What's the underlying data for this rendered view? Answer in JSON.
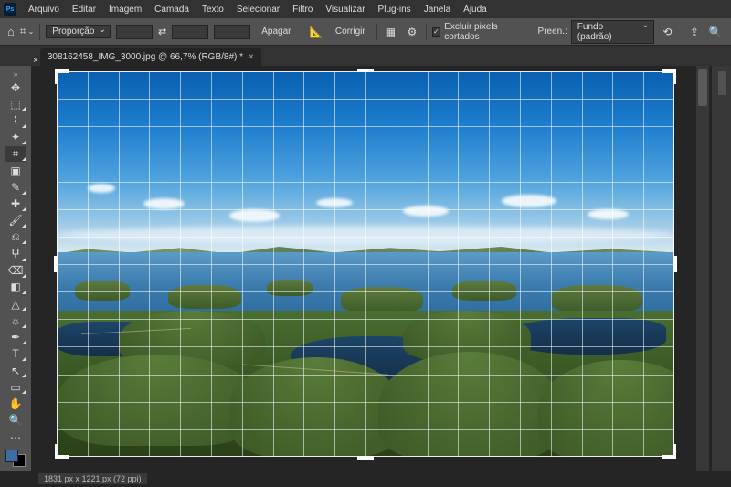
{
  "app": {
    "logo_text": "Ps"
  },
  "menu": {
    "items": [
      "Arquivo",
      "Editar",
      "Imagem",
      "Camada",
      "Texto",
      "Selecionar",
      "Filtro",
      "Visualizar",
      "Plug-ins",
      "Janela",
      "Ajuda"
    ]
  },
  "options": {
    "ratio_label": "Proporção",
    "swap": "⇄",
    "clear_label": "Apagar",
    "straighten_label": "Corrigir",
    "delete_px_label": "Excluir pixels cortados",
    "fill_prefix": "Preen.:",
    "fill_value": "Fundo (padrão)"
  },
  "tab": {
    "title": "308162458_IMG_3000.jpg @ 66,7% (RGB/8#) *",
    "close": "×"
  },
  "tools": {
    "names": [
      "move",
      "rect-marquee",
      "lasso",
      "magic-wand",
      "crop",
      "frame",
      "eyedropper",
      "healing",
      "brush",
      "clone",
      "history-brush",
      "eraser",
      "gradient",
      "blur",
      "dodge",
      "pen",
      "type",
      "path-select",
      "rectangle",
      "hand",
      "zoom",
      "edit-toolbar"
    ],
    "glyphs": [
      "✥",
      "⬚",
      "⌇",
      "✦",
      "⌗",
      "▣",
      "✎",
      "✚",
      "🖌",
      "⎌",
      "ⵖ",
      "⌫",
      "◧",
      "△",
      "☼",
      "✒",
      "T",
      "↖",
      "▭",
      "✋",
      "🔍",
      "⋯"
    ],
    "active_index": 4
  },
  "grid": {
    "cols": 20,
    "rows": 14
  },
  "status": {
    "text": "1831 px x 1221 px (72 ppi)"
  }
}
